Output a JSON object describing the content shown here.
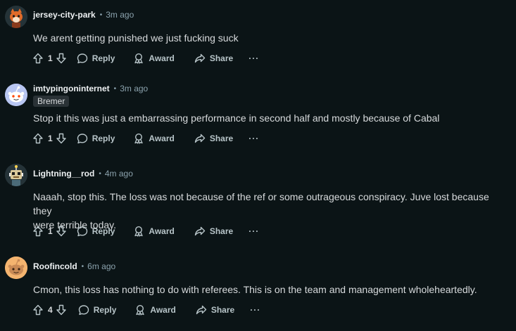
{
  "labels": {
    "reply": "Reply",
    "award": "Award",
    "share": "Share",
    "more": "···",
    "sep": "•"
  },
  "comments": [
    {
      "username": "jersey-city-park",
      "time": "3m ago",
      "flair": "",
      "body": [
        "We arent getting punished we just fucking suck"
      ],
      "votes": "1",
      "avatar": "fox-avatar",
      "avatar_color": "#e06b2a"
    },
    {
      "username": "imtypingoninternet",
      "time": "3m ago",
      "flair": "Bremer",
      "body": [
        "Stop it this was just a embarrassing performance in second half and mostly because of Cabal"
      ],
      "votes": "1",
      "avatar": "snoo-avatar",
      "avatar_color": "#b8c6f2"
    },
    {
      "username": "Lightning__rod",
      "time": "4m ago",
      "flair": "",
      "body": [
        "Naaah, stop this. The loss was not because of the ref or some outrageous conspiracy. Juve lost because they",
        "were terrible today."
      ],
      "votes": "1",
      "avatar": "robot-avatar",
      "avatar_color": "#3a4a52"
    },
    {
      "username": "Roofincold",
      "time": "6m ago",
      "flair": "",
      "body": [
        "Cmon, this loss has nothing to do with referees. This is on the team and management wholeheartedly."
      ],
      "votes": "4",
      "avatar": "snoo-avatar",
      "avatar_color": "#f4b46f"
    }
  ]
}
